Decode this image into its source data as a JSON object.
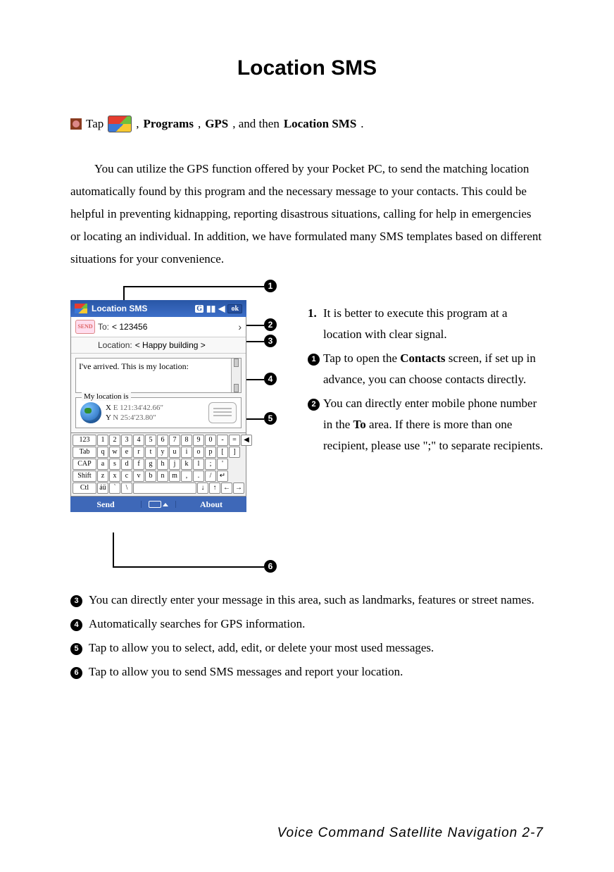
{
  "title": "Location SMS",
  "instruction": {
    "tap": "Tap",
    "programs": "Programs",
    "gps": "GPS",
    "then": ", and then",
    "locsms": "Location SMS",
    "period": "."
  },
  "intro": "You can utilize the GPS function offered by your Pocket PC, to send the matching location automatically found by this program and the necessary message to your contacts. This could be helpful in preventing kidnapping, reporting disastrous situations, calling for help in emergencies or locating an individual. In addition, we have formulated many SMS templates based on different situations for your convenience.",
  "screenshot": {
    "window_title": "Location SMS",
    "status_g": "G",
    "ok": "ok",
    "send_icon": "SEND",
    "to_label": "To:",
    "to_value": "< 123456",
    "loc_label": "Location:",
    "loc_value": "< Happy building >",
    "message": "I've arrived. This is my location:",
    "group_legend": "My location is",
    "coord_x": "E 121:34'42.66\"",
    "coord_y": "N 25:4'23.80\"",
    "keys_row1": [
      "123",
      "1",
      "2",
      "3",
      "4",
      "5",
      "6",
      "7",
      "8",
      "9",
      "0",
      "-",
      "=",
      "◀"
    ],
    "keys_row2": [
      "Tab",
      "q",
      "w",
      "e",
      "r",
      "t",
      "y",
      "u",
      "i",
      "o",
      "p",
      "[",
      "]"
    ],
    "keys_row3": [
      "CAP",
      "a",
      "s",
      "d",
      "f",
      "g",
      "h",
      "j",
      "k",
      "l",
      ";",
      "'"
    ],
    "keys_row4": [
      "Shift",
      "z",
      "x",
      "c",
      "v",
      "b",
      "n",
      "m",
      ",",
      ".",
      "/",
      "↵"
    ],
    "keys_row5": [
      "Ctl",
      "áü",
      "`",
      "\\",
      " ",
      "↓",
      "↑",
      "←",
      "→"
    ],
    "footer_send": "Send",
    "footer_about": "About"
  },
  "callouts": {
    "n1": "1",
    "n2": "2",
    "n3": "3",
    "n4": "4",
    "n5": "5",
    "n6": "6"
  },
  "right": {
    "tip_num": "1.",
    "tip": "It is better to execute this program at a location with clear signal.",
    "i1a": "Tap to open the ",
    "i1b": "Contacts",
    "i1c": " screen, if set up in advance, you can choose contacts directly.",
    "i2a": "You can directly enter mobile phone number in the ",
    "i2b": "To",
    "i2c": " area. If there is more than one recipient, please use \";\" to separate recipients."
  },
  "lower": {
    "i3": "You can directly enter your message in this area, such as landmarks, features or street names.",
    "i4": "Automatically searches for GPS information.",
    "i5": "Tap to allow you to select, add, edit, or delete your most used messages.",
    "i6": "Tap to allow you to send SMS messages and report your location."
  },
  "footer": "Voice Command Satellite Navigation   2-7"
}
